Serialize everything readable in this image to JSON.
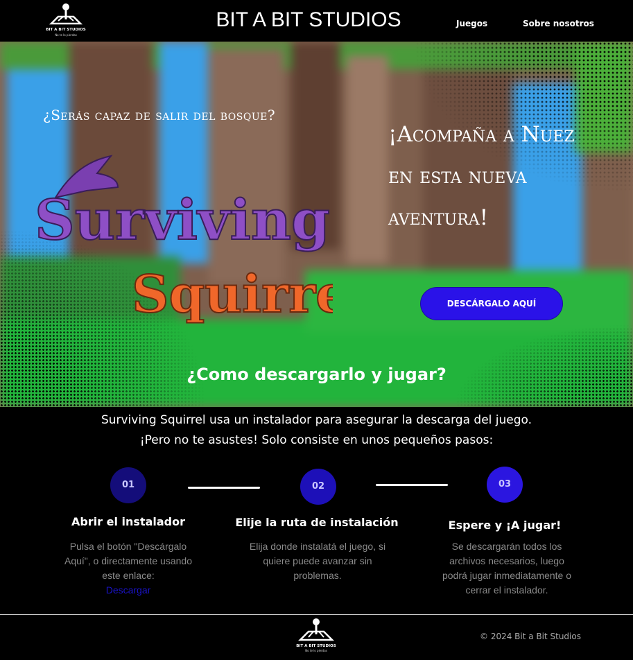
{
  "header": {
    "logo_text": "BIT A BIT STUDIOS",
    "logo_tagline": "No te lo pierdas",
    "brand": "BIT A BIT STUDIOS",
    "nav": [
      "Juegos",
      "Sobre nosotros"
    ]
  },
  "hero": {
    "question": "¿Serás capaz de salir del bosque?",
    "tagline": "¡Acompaña a Nuez en esta nueva aventura!",
    "logo_word1": "Surviving",
    "logo_word2": "Squirrel",
    "cta": "DESCÁRGALO AQUÍ",
    "how_title": "¿Como descargarlo y jugar?",
    "colors": {
      "cta": "#2a12e8",
      "logo_word1": "#8e4fc6",
      "logo_word2": "#f0672a"
    }
  },
  "intro": {
    "line1": "Surviving Squirrel usa un instalador para asegurar la descarga del juego.",
    "line2": "¡Pero no te asustes! Solo consiste en unos pequeños pasos:"
  },
  "steps": [
    {
      "number": "01",
      "title": "Abrir el instalador",
      "desc": "Pulsa el botón \"Descárgalo Aquí\", o directamente usando este enlace:",
      "link": "Descargar",
      "color": "#140d7a"
    },
    {
      "number": "02",
      "title": "Elije la ruta de instalación",
      "desc": "Elija donde instalatá el juego, si quiere puede avanzar sin problemas.",
      "color": "#1d10b8"
    },
    {
      "number": "03",
      "title": "Espere y ¡A jugar!",
      "desc": "Se descargarán todos los archivos necesarios, luego podrá jugar inmediatamente o cerrar el instalador.",
      "color": "#2b16e0"
    }
  ],
  "footer": {
    "logo_text": "BIT A BIT STUDIOS",
    "logo_tagline": "No te lo pierdas",
    "copyright": "© 2024  Bit a Bit Studios"
  }
}
